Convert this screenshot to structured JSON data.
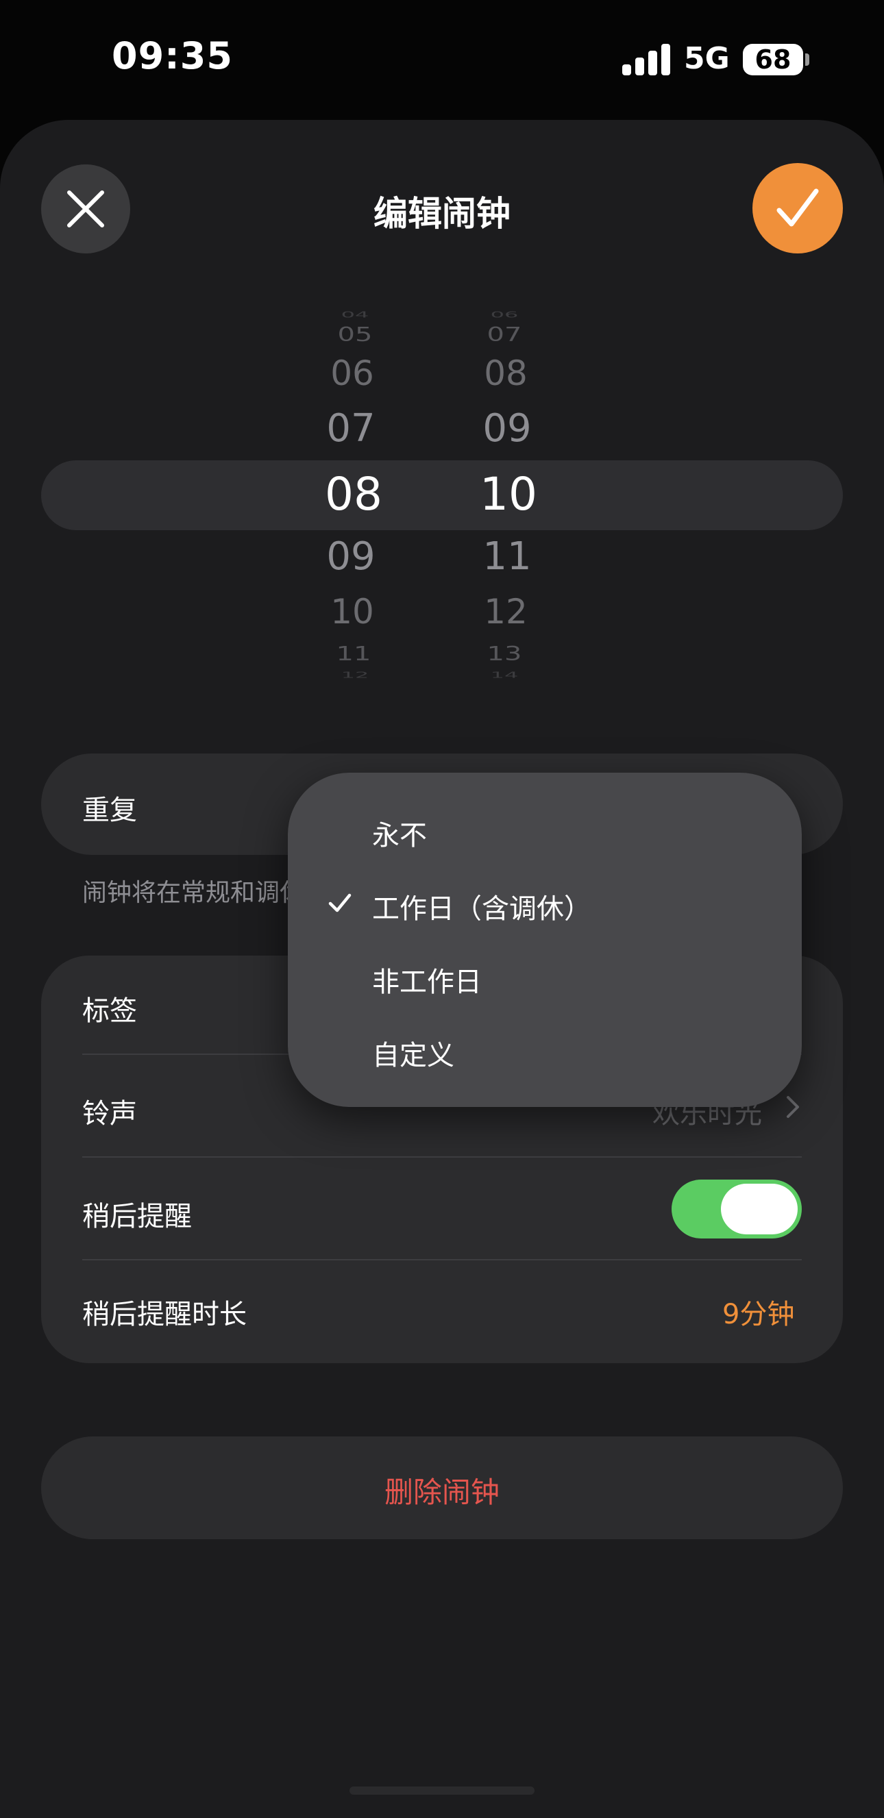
{
  "status_bar": {
    "time": "09:35",
    "network": "5G",
    "battery": "68"
  },
  "header": {
    "title": "编辑闹钟",
    "close_icon": "close-icon",
    "confirm_icon": "checkmark-icon"
  },
  "picker": {
    "hours": [
      "04",
      "05",
      "06",
      "07",
      "08",
      "09",
      "10",
      "11",
      "12"
    ],
    "minutes": [
      "06",
      "07",
      "08",
      "09",
      "10",
      "11",
      "12",
      "13",
      "14"
    ],
    "selected_hour": "08",
    "selected_minute": "10"
  },
  "repeat": {
    "label": "重复",
    "note": "闹钟将在常规和调休"
  },
  "settings": {
    "label_row": "标签",
    "ringtone_row": "铃声",
    "ringtone_value": "欢乐时光",
    "snooze_row": "稍后提醒",
    "snooze_on": true,
    "snooze_duration_row": "稍后提醒时长",
    "snooze_duration_value": "9分钟"
  },
  "delete_button": "删除闹钟",
  "repeat_menu": {
    "items": [
      "永不",
      "工作日（含调休）",
      "非工作日",
      "自定义"
    ],
    "selected_index": 1
  },
  "colors": {
    "accent": "#f0903a",
    "toggle_on": "#5bcc62",
    "destructive": "#e5554e",
    "sheet": "#1c1c1e",
    "card": "#2c2c2e"
  }
}
